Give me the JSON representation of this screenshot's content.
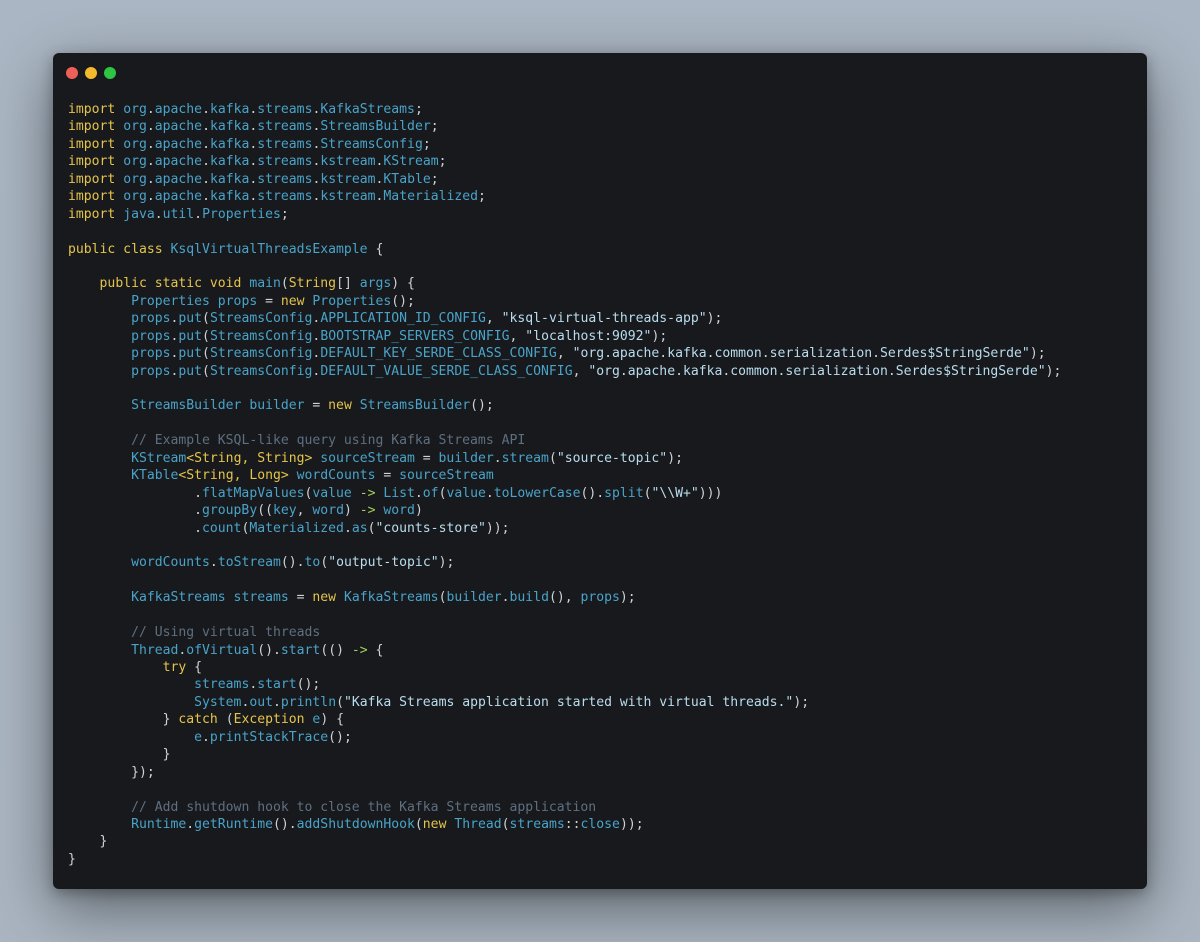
{
  "window": {
    "controls": [
      {
        "name": "close",
        "color": "#ee5f57"
      },
      {
        "name": "minimize",
        "color": "#f5b92c"
      },
      {
        "name": "maximize",
        "color": "#2ec542"
      }
    ]
  },
  "code": {
    "language": "java",
    "colors": {
      "keyword": "#e5c44c",
      "identifier": "#4aa3c9",
      "punctuation": "#cfd3d8",
      "string": "#b9dcee",
      "comment": "#5f6f80",
      "operator": "#a6d05b",
      "background": "#17191c"
    },
    "lines": [
      [
        [
          "kw",
          "import"
        ],
        [
          "id",
          " org"
        ],
        [
          "pn",
          "."
        ],
        [
          "id",
          "apache"
        ],
        [
          "pn",
          "."
        ],
        [
          "id",
          "kafka"
        ],
        [
          "pn",
          "."
        ],
        [
          "id",
          "streams"
        ],
        [
          "pn",
          "."
        ],
        [
          "id",
          "KafkaStreams"
        ],
        [
          "pn",
          ";"
        ]
      ],
      [
        [
          "kw",
          "import"
        ],
        [
          "id",
          " org"
        ],
        [
          "pn",
          "."
        ],
        [
          "id",
          "apache"
        ],
        [
          "pn",
          "."
        ],
        [
          "id",
          "kafka"
        ],
        [
          "pn",
          "."
        ],
        [
          "id",
          "streams"
        ],
        [
          "pn",
          "."
        ],
        [
          "id",
          "StreamsBuilder"
        ],
        [
          "pn",
          ";"
        ]
      ],
      [
        [
          "kw",
          "import"
        ],
        [
          "id",
          " org"
        ],
        [
          "pn",
          "."
        ],
        [
          "id",
          "apache"
        ],
        [
          "pn",
          "."
        ],
        [
          "id",
          "kafka"
        ],
        [
          "pn",
          "."
        ],
        [
          "id",
          "streams"
        ],
        [
          "pn",
          "."
        ],
        [
          "id",
          "StreamsConfig"
        ],
        [
          "pn",
          ";"
        ]
      ],
      [
        [
          "kw",
          "import"
        ],
        [
          "id",
          " org"
        ],
        [
          "pn",
          "."
        ],
        [
          "id",
          "apache"
        ],
        [
          "pn",
          "."
        ],
        [
          "id",
          "kafka"
        ],
        [
          "pn",
          "."
        ],
        [
          "id",
          "streams"
        ],
        [
          "pn",
          "."
        ],
        [
          "id",
          "kstream"
        ],
        [
          "pn",
          "."
        ],
        [
          "id",
          "KStream"
        ],
        [
          "pn",
          ";"
        ]
      ],
      [
        [
          "kw",
          "import"
        ],
        [
          "id",
          " org"
        ],
        [
          "pn",
          "."
        ],
        [
          "id",
          "apache"
        ],
        [
          "pn",
          "."
        ],
        [
          "id",
          "kafka"
        ],
        [
          "pn",
          "."
        ],
        [
          "id",
          "streams"
        ],
        [
          "pn",
          "."
        ],
        [
          "id",
          "kstream"
        ],
        [
          "pn",
          "."
        ],
        [
          "id",
          "KTable"
        ],
        [
          "pn",
          ";"
        ]
      ],
      [
        [
          "kw",
          "import"
        ],
        [
          "id",
          " org"
        ],
        [
          "pn",
          "."
        ],
        [
          "id",
          "apache"
        ],
        [
          "pn",
          "."
        ],
        [
          "id",
          "kafka"
        ],
        [
          "pn",
          "."
        ],
        [
          "id",
          "streams"
        ],
        [
          "pn",
          "."
        ],
        [
          "id",
          "kstream"
        ],
        [
          "pn",
          "."
        ],
        [
          "id",
          "Materialized"
        ],
        [
          "pn",
          ";"
        ]
      ],
      [
        [
          "kw",
          "import"
        ],
        [
          "id",
          " java"
        ],
        [
          "pn",
          "."
        ],
        [
          "id",
          "util"
        ],
        [
          "pn",
          "."
        ],
        [
          "id",
          "Properties"
        ],
        [
          "pn",
          ";"
        ]
      ],
      [],
      [
        [
          "kw",
          "public class "
        ],
        [
          "id",
          "KsqlVirtualThreadsExample"
        ],
        [
          "pn",
          " {"
        ]
      ],
      [],
      [
        [
          "pn",
          "    "
        ],
        [
          "kw",
          "public static void "
        ],
        [
          "id",
          "main"
        ],
        [
          "pn",
          "("
        ],
        [
          "kw",
          "String"
        ],
        [
          "pn",
          "[] "
        ],
        [
          "id",
          "args"
        ],
        [
          "pn",
          ") {"
        ]
      ],
      [
        [
          "pn",
          "        "
        ],
        [
          "id",
          "Properties props "
        ],
        [
          "pn",
          "= "
        ],
        [
          "kw",
          "new "
        ],
        [
          "id",
          "Properties"
        ],
        [
          "pn",
          "();"
        ]
      ],
      [
        [
          "pn",
          "        "
        ],
        [
          "id",
          "props"
        ],
        [
          "pn",
          "."
        ],
        [
          "id",
          "put"
        ],
        [
          "pn",
          "("
        ],
        [
          "id",
          "StreamsConfig"
        ],
        [
          "pn",
          "."
        ],
        [
          "id",
          "APPLICATION_ID_CONFIG"
        ],
        [
          "pn",
          ", "
        ],
        [
          "str",
          "\"ksql-virtual-threads-app\""
        ],
        [
          "pn",
          ");"
        ]
      ],
      [
        [
          "pn",
          "        "
        ],
        [
          "id",
          "props"
        ],
        [
          "pn",
          "."
        ],
        [
          "id",
          "put"
        ],
        [
          "pn",
          "("
        ],
        [
          "id",
          "StreamsConfig"
        ],
        [
          "pn",
          "."
        ],
        [
          "id",
          "BOOTSTRAP_SERVERS_CONFIG"
        ],
        [
          "pn",
          ", "
        ],
        [
          "str",
          "\"localhost:9092\""
        ],
        [
          "pn",
          ");"
        ]
      ],
      [
        [
          "pn",
          "        "
        ],
        [
          "id",
          "props"
        ],
        [
          "pn",
          "."
        ],
        [
          "id",
          "put"
        ],
        [
          "pn",
          "("
        ],
        [
          "id",
          "StreamsConfig"
        ],
        [
          "pn",
          "."
        ],
        [
          "id",
          "DEFAULT_KEY_SERDE_CLASS_CONFIG"
        ],
        [
          "pn",
          ", "
        ],
        [
          "str",
          "\"org.apache.kafka.common.serialization.Serdes$StringSerde\""
        ],
        [
          "pn",
          ");"
        ]
      ],
      [
        [
          "pn",
          "        "
        ],
        [
          "id",
          "props"
        ],
        [
          "pn",
          "."
        ],
        [
          "id",
          "put"
        ],
        [
          "pn",
          "("
        ],
        [
          "id",
          "StreamsConfig"
        ],
        [
          "pn",
          "."
        ],
        [
          "id",
          "DEFAULT_VALUE_SERDE_CLASS_CONFIG"
        ],
        [
          "pn",
          ", "
        ],
        [
          "str",
          "\"org.apache.kafka.common.serialization.Serdes$StringSerde\""
        ],
        [
          "pn",
          ");"
        ]
      ],
      [],
      [
        [
          "pn",
          "        "
        ],
        [
          "id",
          "StreamsBuilder builder "
        ],
        [
          "pn",
          "= "
        ],
        [
          "kw",
          "new "
        ],
        [
          "id",
          "StreamsBuilder"
        ],
        [
          "pn",
          "();"
        ]
      ],
      [],
      [
        [
          "pn",
          "        "
        ],
        [
          "cmt",
          "// Example KSQL-like query using Kafka Streams API"
        ]
      ],
      [
        [
          "pn",
          "        "
        ],
        [
          "id",
          "KStream"
        ],
        [
          "kw",
          "<String, String> "
        ],
        [
          "id",
          "sourceStream "
        ],
        [
          "pn",
          "= "
        ],
        [
          "id",
          "builder"
        ],
        [
          "pn",
          "."
        ],
        [
          "id",
          "stream"
        ],
        [
          "pn",
          "("
        ],
        [
          "str",
          "\"source-topic\""
        ],
        [
          "pn",
          ");"
        ]
      ],
      [
        [
          "pn",
          "        "
        ],
        [
          "id",
          "KTable"
        ],
        [
          "kw",
          "<String, Long> "
        ],
        [
          "id",
          "wordCounts "
        ],
        [
          "pn",
          "= "
        ],
        [
          "id",
          "sourceStream"
        ]
      ],
      [
        [
          "pn",
          "                ."
        ],
        [
          "id",
          "flatMapValues"
        ],
        [
          "pn",
          "("
        ],
        [
          "id",
          "value "
        ],
        [
          "op",
          "-> "
        ],
        [
          "id",
          "List"
        ],
        [
          "pn",
          "."
        ],
        [
          "id",
          "of"
        ],
        [
          "pn",
          "("
        ],
        [
          "id",
          "value"
        ],
        [
          "pn",
          "."
        ],
        [
          "id",
          "toLowerCase"
        ],
        [
          "pn",
          "()."
        ],
        [
          "id",
          "split"
        ],
        [
          "pn",
          "("
        ],
        [
          "str",
          "\"\\\\W+\""
        ],
        [
          "pn",
          ")))"
        ]
      ],
      [
        [
          "pn",
          "                ."
        ],
        [
          "id",
          "groupBy"
        ],
        [
          "pn",
          "(("
        ],
        [
          "id",
          "key"
        ],
        [
          "pn",
          ", "
        ],
        [
          "id",
          "word"
        ],
        [
          "pn",
          ") "
        ],
        [
          "op",
          "-> "
        ],
        [
          "id",
          "word"
        ],
        [
          "pn",
          ")"
        ]
      ],
      [
        [
          "pn",
          "                ."
        ],
        [
          "id",
          "count"
        ],
        [
          "pn",
          "("
        ],
        [
          "id",
          "Materialized"
        ],
        [
          "pn",
          "."
        ],
        [
          "id",
          "as"
        ],
        [
          "pn",
          "("
        ],
        [
          "str",
          "\"counts-store\""
        ],
        [
          "pn",
          "));"
        ]
      ],
      [],
      [
        [
          "pn",
          "        "
        ],
        [
          "id",
          "wordCounts"
        ],
        [
          "pn",
          "."
        ],
        [
          "id",
          "toStream"
        ],
        [
          "pn",
          "()."
        ],
        [
          "id",
          "to"
        ],
        [
          "pn",
          "("
        ],
        [
          "str",
          "\"output-topic\""
        ],
        [
          "pn",
          ");"
        ]
      ],
      [],
      [
        [
          "pn",
          "        "
        ],
        [
          "id",
          "KafkaStreams streams "
        ],
        [
          "pn",
          "= "
        ],
        [
          "kw",
          "new "
        ],
        [
          "id",
          "KafkaStreams"
        ],
        [
          "pn",
          "("
        ],
        [
          "id",
          "builder"
        ],
        [
          "pn",
          "."
        ],
        [
          "id",
          "build"
        ],
        [
          "pn",
          "(), "
        ],
        [
          "id",
          "props"
        ],
        [
          "pn",
          ");"
        ]
      ],
      [],
      [
        [
          "pn",
          "        "
        ],
        [
          "cmt",
          "// Using virtual threads"
        ]
      ],
      [
        [
          "pn",
          "        "
        ],
        [
          "id",
          "Thread"
        ],
        [
          "pn",
          "."
        ],
        [
          "id",
          "ofVirtual"
        ],
        [
          "pn",
          "()."
        ],
        [
          "id",
          "start"
        ],
        [
          "pn",
          "(() "
        ],
        [
          "op",
          "-> "
        ],
        [
          "pn",
          "{"
        ]
      ],
      [
        [
          "pn",
          "            "
        ],
        [
          "kw",
          "try "
        ],
        [
          "pn",
          "{"
        ]
      ],
      [
        [
          "pn",
          "                "
        ],
        [
          "id",
          "streams"
        ],
        [
          "pn",
          "."
        ],
        [
          "id",
          "start"
        ],
        [
          "pn",
          "();"
        ]
      ],
      [
        [
          "pn",
          "                "
        ],
        [
          "id",
          "System"
        ],
        [
          "pn",
          "."
        ],
        [
          "id",
          "out"
        ],
        [
          "pn",
          "."
        ],
        [
          "id",
          "println"
        ],
        [
          "pn",
          "("
        ],
        [
          "str",
          "\"Kafka Streams application started with virtual threads.\""
        ],
        [
          "pn",
          ");"
        ]
      ],
      [
        [
          "pn",
          "            } "
        ],
        [
          "kw",
          "catch "
        ],
        [
          "pn",
          "("
        ],
        [
          "kw",
          "Exception "
        ],
        [
          "id",
          "e"
        ],
        [
          "pn",
          ") {"
        ]
      ],
      [
        [
          "pn",
          "                "
        ],
        [
          "id",
          "e"
        ],
        [
          "pn",
          "."
        ],
        [
          "id",
          "printStackTrace"
        ],
        [
          "pn",
          "();"
        ]
      ],
      [
        [
          "pn",
          "            }"
        ]
      ],
      [
        [
          "pn",
          "        });"
        ]
      ],
      [],
      [
        [
          "pn",
          "        "
        ],
        [
          "cmt",
          "// Add shutdown hook to close the Kafka Streams application"
        ]
      ],
      [
        [
          "pn",
          "        "
        ],
        [
          "id",
          "Runtime"
        ],
        [
          "pn",
          "."
        ],
        [
          "id",
          "getRuntime"
        ],
        [
          "pn",
          "()."
        ],
        [
          "id",
          "addShutdownHook"
        ],
        [
          "pn",
          "("
        ],
        [
          "kw",
          "new "
        ],
        [
          "id",
          "Thread"
        ],
        [
          "pn",
          "("
        ],
        [
          "id",
          "streams"
        ],
        [
          "pn",
          "::"
        ],
        [
          "id",
          "close"
        ],
        [
          "pn",
          "));"
        ]
      ],
      [
        [
          "pn",
          "    }"
        ]
      ],
      [
        [
          "pn",
          "}"
        ]
      ]
    ]
  }
}
